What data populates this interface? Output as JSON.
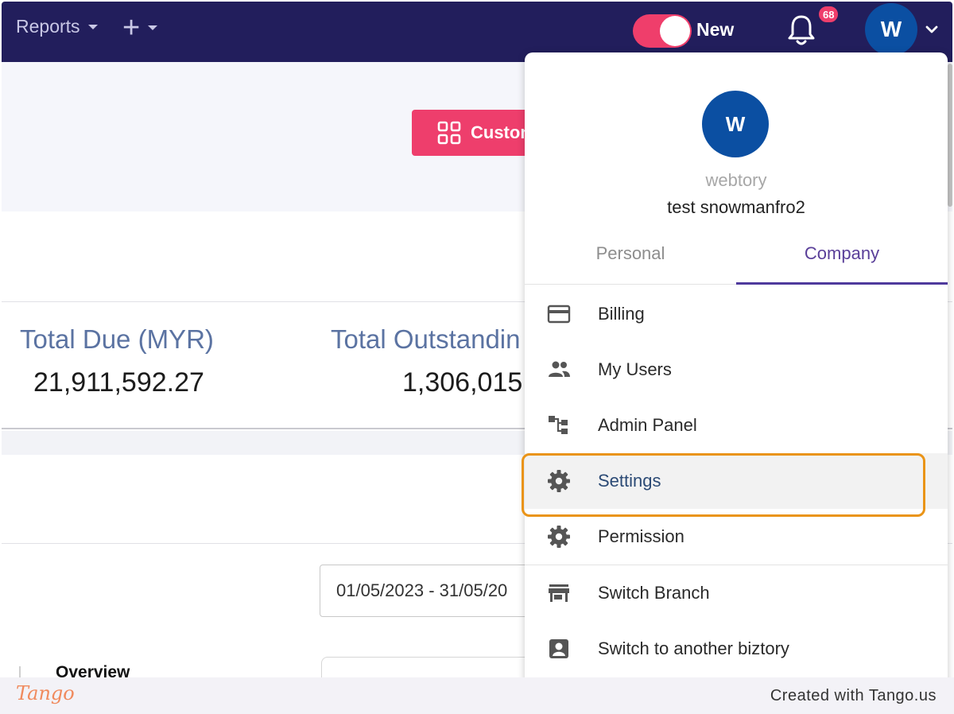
{
  "topbar": {
    "reports_label": "Reports",
    "toggle_label": "New",
    "notification_count": "68",
    "avatar_initial": "W"
  },
  "page": {
    "customize_button_label": "Custom",
    "stats": [
      {
        "label": "Total Due (MYR)",
        "value": "21,911,592.27"
      },
      {
        "label": "Total Outstandin",
        "value": "1,306,015"
      }
    ],
    "date_range_value": "01/05/2023 - 31/05/20",
    "overview_label": "Overview"
  },
  "menu": {
    "avatar_initial": "W",
    "company_name": "webtory",
    "user_name": "test snowmanfro2",
    "tabs": [
      "Personal",
      "Company"
    ],
    "active_tab": "Company",
    "items": [
      {
        "label": "Billing",
        "icon": "credit-card-icon"
      },
      {
        "label": "My Users",
        "icon": "users-icon"
      },
      {
        "label": "Admin Panel",
        "icon": "hierarchy-icon"
      },
      {
        "label": "Settings",
        "icon": "gear-icon"
      },
      {
        "label": "Permission",
        "icon": "gear-icon"
      },
      {
        "label": "Switch Branch",
        "icon": "store-icon"
      },
      {
        "label": "Switch to another biztory",
        "icon": "account-box-icon"
      }
    ],
    "highlighted_item": "Settings"
  },
  "footer": {
    "logo_text": "Tango",
    "credit": "Created with Tango.us"
  },
  "colors": {
    "nav_bg": "#221e5c",
    "accent_pink": "#ef3e6b",
    "avatar_blue": "#0b4fa2",
    "tab_active": "#5a3f99",
    "highlight_orange": "#ea9417"
  }
}
